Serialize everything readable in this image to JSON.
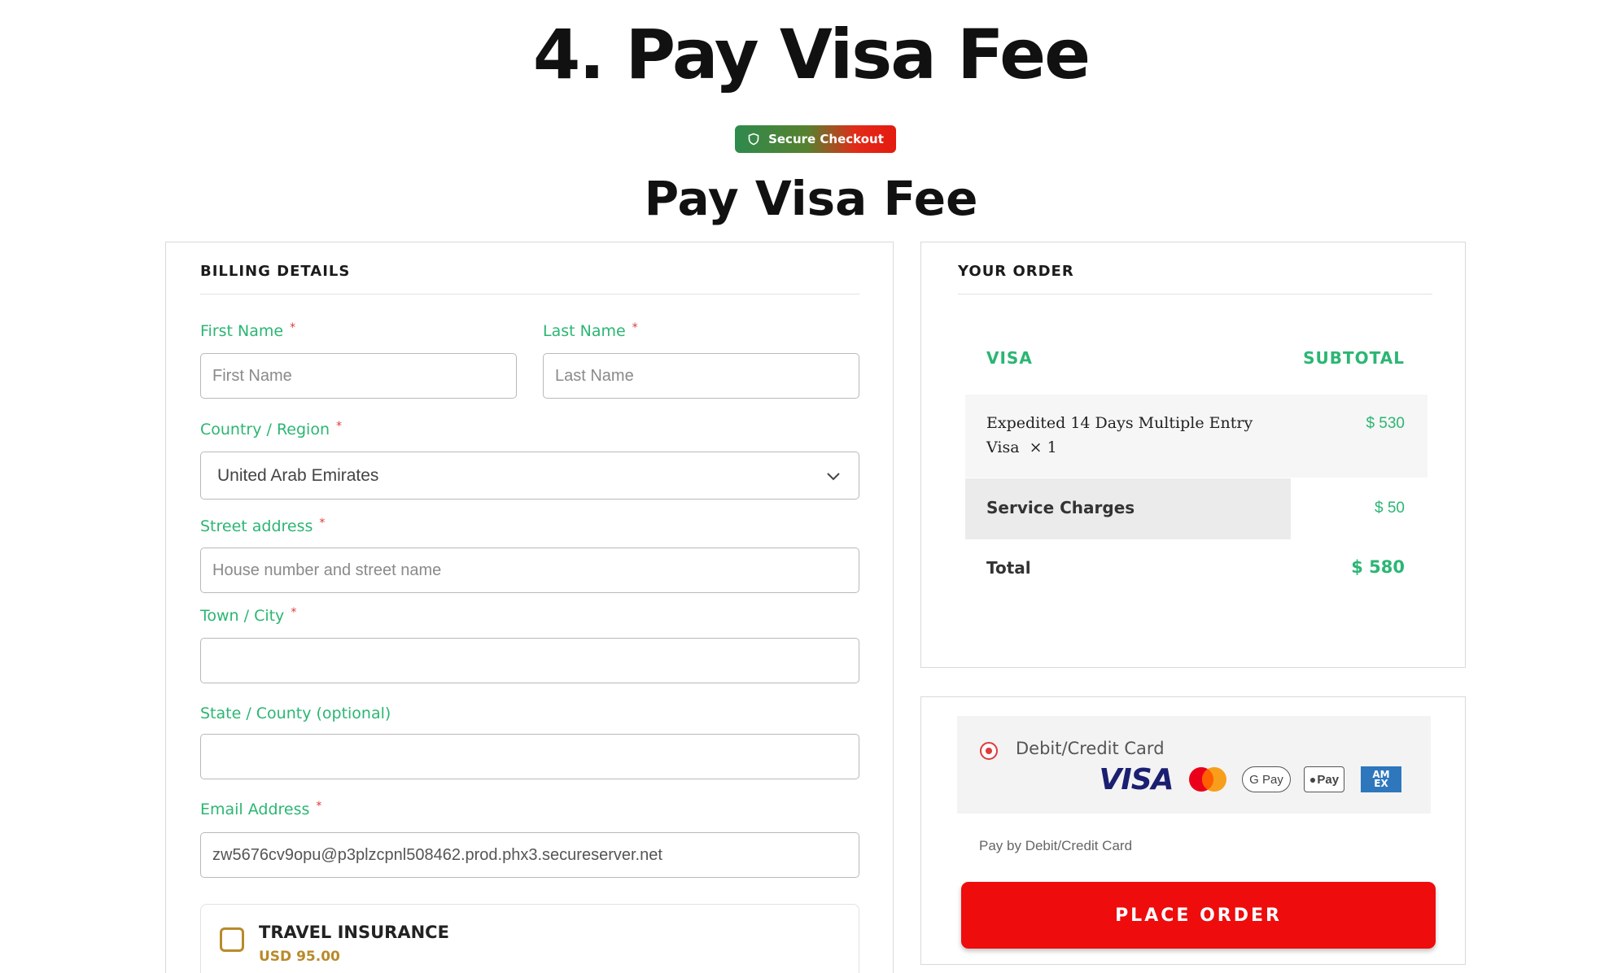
{
  "page": {
    "heading": "4. Pay Visa Fee",
    "secure_badge": "Secure Checkout",
    "subheading": "Pay Visa Fee"
  },
  "billing": {
    "title": "BILLING DETAILS",
    "first_name": {
      "label": "First Name",
      "required": "*",
      "placeholder": "First Name",
      "value": ""
    },
    "last_name": {
      "label": "Last Name",
      "required": "*",
      "placeholder": "Last Name",
      "value": ""
    },
    "country": {
      "label": "Country / Region",
      "required": "*",
      "selected": "United Arab Emirates"
    },
    "street": {
      "label": "Street address",
      "required": "*",
      "placeholder": "House number and street name",
      "value": ""
    },
    "city": {
      "label": "Town / City",
      "required": "*",
      "value": ""
    },
    "state": {
      "label": "State / County (optional)",
      "value": ""
    },
    "email": {
      "label": "Email Address",
      "required": "*",
      "value": "zw5676cv9opu@p3plzcpnl508462.prod.phx3.secureserver.net"
    },
    "insurance": {
      "title": "TRAVEL INSURANCE",
      "price": "USD 95.00",
      "checked": false
    }
  },
  "order": {
    "title": "YOUR ORDER",
    "col_left": "VISA",
    "col_right": "SUBTOTAL",
    "item": {
      "name_line1": "Expedited 14 Days Multiple Entry",
      "name_line2": "Visa",
      "qty": "× 1",
      "price": "$ 530"
    },
    "service": {
      "label": "Service Charges",
      "price": "$ 50"
    },
    "total": {
      "label": "Total",
      "price": "$ 580"
    }
  },
  "payment": {
    "method_label": "Debit/Credit Card",
    "card_icons": {
      "visa": "VISA",
      "gpay": "G Pay",
      "apay": "Pay",
      "amex_top": "AM",
      "amex_bottom": "EX"
    },
    "note": "Pay by Debit/Credit Card",
    "place_order": "PLACE ORDER"
  },
  "colors": {
    "accent_green": "#2bb673",
    "required_red": "#e03a3a",
    "button_red": "#ee0c0c",
    "insurance_gold": "#b98a2b"
  }
}
